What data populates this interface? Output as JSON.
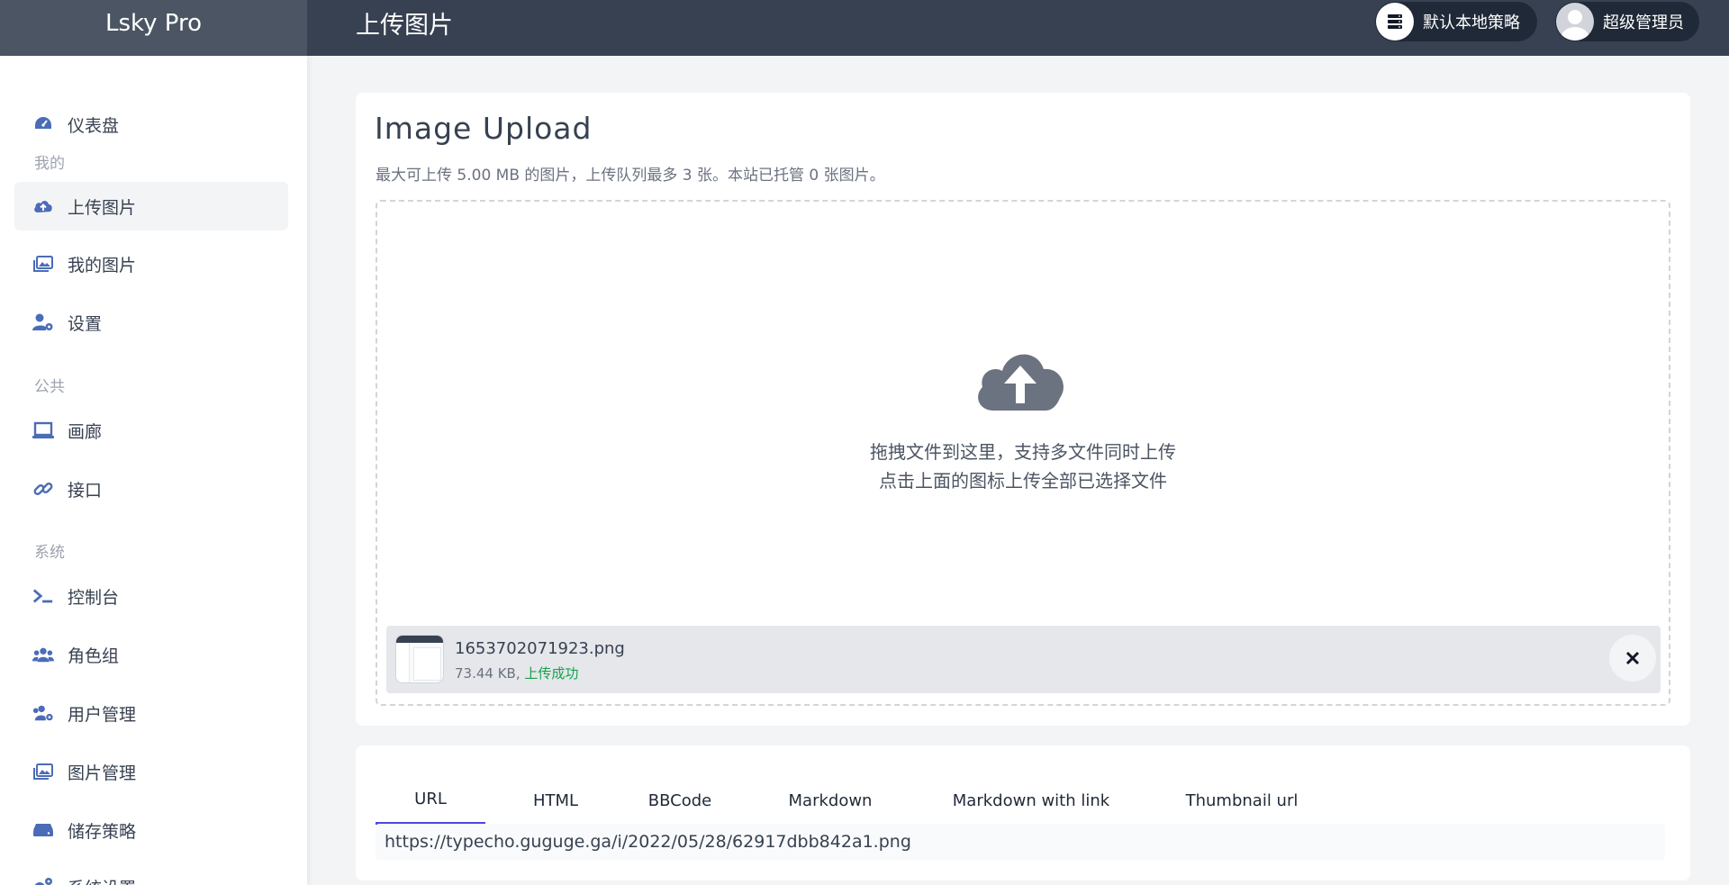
{
  "app": {
    "brand": "Lsky Pro",
    "page_title": "上传图片"
  },
  "header": {
    "strategy_label": "默认本地策略",
    "user_label": "超级管理员"
  },
  "sidebar": {
    "dashboard": "仪表盘",
    "section_mine": "我的",
    "upload": "上传图片",
    "my_images": "我的图片",
    "settings": "设置",
    "section_public": "公共",
    "gallery": "画廊",
    "api": "接口",
    "section_system": "系统",
    "console": "控制台",
    "roles": "角色组",
    "users": "用户管理",
    "images": "图片管理",
    "storage": "储存策略",
    "system_settings": "系统设置"
  },
  "upload": {
    "title": "Image Upload",
    "subtitle": "最大可上传 5.00 MB 的图片，上传队列最多 3 张。本站已托管 0 张图片。",
    "drop_line1": "拖拽文件到这里，支持多文件同时上传",
    "drop_line2": "点击上面的图标上传全部已选择文件"
  },
  "file": {
    "name": "1653702071923.png",
    "size": "73.44 KB,",
    "status": "上传成功"
  },
  "links": {
    "tabs": [
      "URL",
      "HTML",
      "BBCode",
      "Markdown",
      "Markdown with link",
      "Thumbnail url"
    ],
    "active_tab": "URL",
    "value": "https://typecho.guguge.ga/i/2022/05/28/62917dbb842a1.png"
  },
  "colors": {
    "topbar": "#374151",
    "accent": "#4f46e5",
    "success": "#16a34a",
    "icon": "#4b6cb7"
  }
}
